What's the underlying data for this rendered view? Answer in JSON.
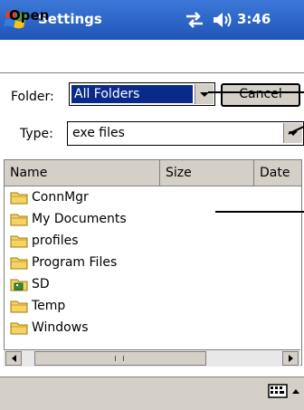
{
  "titlebar": {
    "title": "Settings",
    "time": "3:46",
    "bg_color": "#2a62c8",
    "icons": [
      "windows-start-icon",
      "connectivity-icon",
      "speaker-icon"
    ]
  },
  "dialog": {
    "title": "Open",
    "folder_label": "Folder:",
    "folder_value": "All Folders",
    "cancel_label": "Cancel",
    "type_label": "Type:",
    "type_value": "exe files"
  },
  "list": {
    "columns": [
      "Name",
      "Size",
      "Date"
    ],
    "rows": [
      {
        "name": "ConnMgr",
        "icon": "folder-icon"
      },
      {
        "name": "My Documents",
        "icon": "folder-icon"
      },
      {
        "name": "profiles",
        "icon": "folder-icon"
      },
      {
        "name": "Program Files",
        "icon": "folder-icon"
      },
      {
        "name": "SD",
        "icon": "storage-card-icon"
      },
      {
        "name": "Temp",
        "icon": "folder-icon"
      },
      {
        "name": "Windows",
        "icon": "folder-icon"
      }
    ]
  },
  "bottom": {
    "icons": [
      "keyboard-icon",
      "input-menu-arrow-icon"
    ]
  }
}
